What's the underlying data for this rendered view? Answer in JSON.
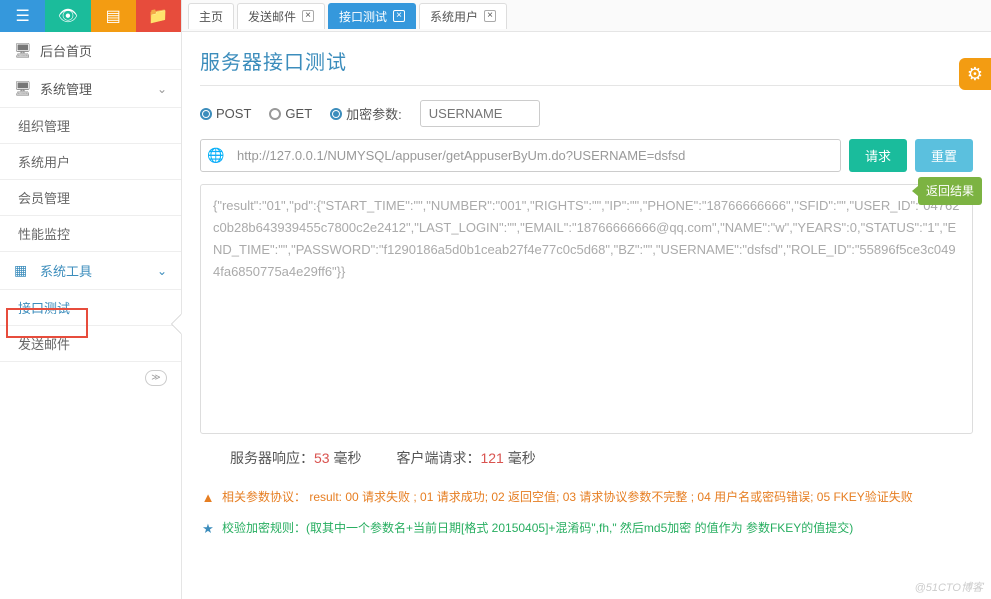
{
  "sidebar": {
    "home": "后台首页",
    "sys_mgmt": "系统管理",
    "sub_org": "组织管理",
    "sub_user": "系统用户",
    "sub_member": "会员管理",
    "sub_perf": "性能监控",
    "sys_tools": "系统工具",
    "sub_api": "接口测试",
    "sub_mail": "发送邮件"
  },
  "tabs": {
    "home": "主页",
    "mail": "发送邮件",
    "api": "接口测试",
    "sysuser": "系统用户"
  },
  "page": {
    "title": "服务器接口测试"
  },
  "form": {
    "post": "POST",
    "get": "GET",
    "encrypt": "加密参数:",
    "placeholder": "USERNAME",
    "url": "http://127.0.0.1/NUMYSQL/appuser/getAppuserByUm.do?USERNAME=dsfsd",
    "request_btn": "请求",
    "reset_btn": "重置",
    "result_tag": "返回结果"
  },
  "response_text": "{\"result\":\"01\",\"pd\":{\"START_TIME\":\"\",\"NUMBER\":\"001\",\"RIGHTS\":\"\",\"IP\":\"\",\"PHONE\":\"18766666666\",\"SFID\":\"\",\"USER_ID\":\"04762c0b28b643939455c7800c2e2412\",\"LAST_LOGIN\":\"\",\"EMAIL\":\"18766666666@qq.com\",\"NAME\":\"w\",\"YEARS\":0,\"STATUS\":\"1\",\"END_TIME\":\"\",\"PASSWORD\":\"f1290186a5d0b1ceab27f4e77c0c5d68\",\"BZ\":\"\",\"USERNAME\":\"dsfsd\",\"ROLE_ID\":\"55896f5ce3c0494fa6850775a4e29ff6\"}}",
  "metrics": {
    "server_label": "服务器响应：",
    "server_value": "53",
    "server_unit": " 毫秒",
    "client_label": "客户端请求：",
    "client_value": "121",
    "client_unit": " 毫秒"
  },
  "info": {
    "line1": "相关参数协议： result: 00 请求失败 ; 01 请求成功; 02 返回空值; 03 请求协议参数不完整 ; 04 用户名或密码错误; 05 FKEY验证失败",
    "line2": "校验加密规则：(取其中一个参数名+当前日期[格式 20150405]+混淆码\",fh,\" 然后md5加密 的值作为 参数FKEY的值提交)"
  },
  "watermark": "@51CTO博客"
}
